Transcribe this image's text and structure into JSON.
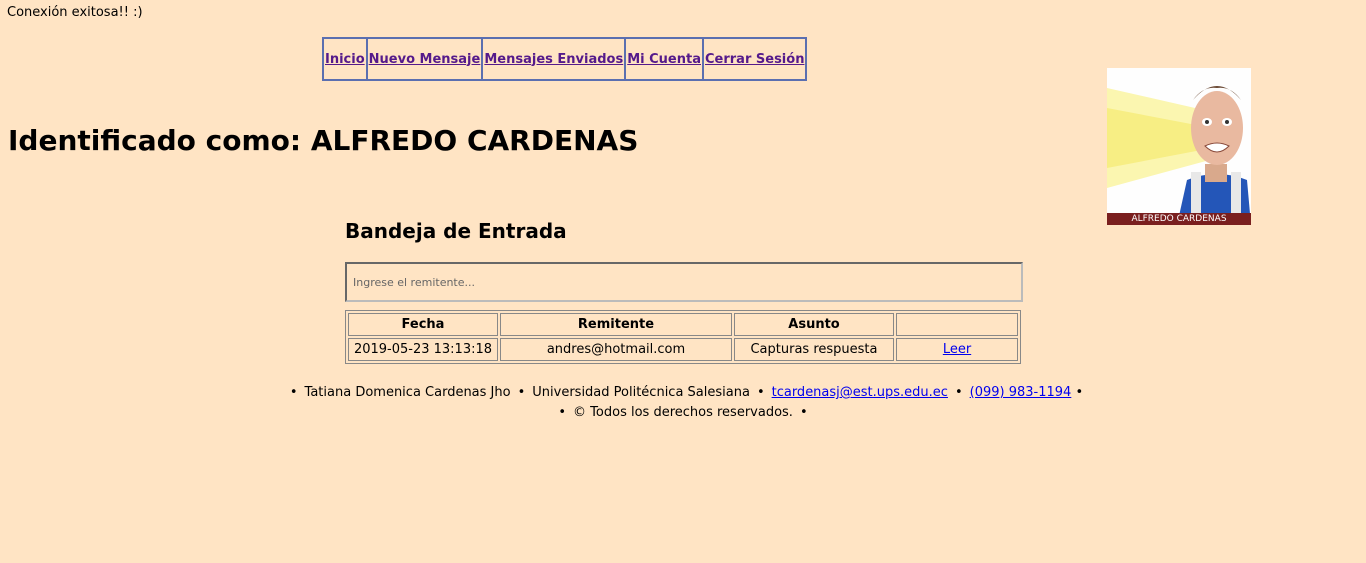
{
  "status": "Conexión exitosa!! :)",
  "nav": {
    "items": [
      "Inicio",
      "Nuevo Mensaje",
      "Mensajes Enviados",
      "Mi Cuenta",
      "Cerrar Sesión"
    ],
    "color": "#551a8b"
  },
  "user": {
    "label": "Identificado como:",
    "name": "ALFREDO CARDENAS",
    "avatar_caption": "ALFREDO CARDENAS"
  },
  "inbox": {
    "title": "Bandeja de Entrada",
    "search_placeholder": "Ingrese el remitente...",
    "columns": [
      "Fecha",
      "Remitente",
      "Asunto",
      ""
    ],
    "rows": [
      {
        "fecha": "2019-05-23 13:13:18",
        "remitente": "andres@hotmail.com",
        "asunto": "Capturas respuesta",
        "accion": "Leer"
      }
    ]
  },
  "footer": {
    "author": "Tatiana Domenica Cardenas Jho",
    "university": "Universidad Politécnica Salesiana",
    "email": "tcardenasj@est.ups.edu.ec",
    "phone": "(099) 983-1194",
    "copyright": "© Todos los derechos reservados."
  },
  "colors": {
    "background": "#ffe4c4",
    "nav_border": "#5b6fb0",
    "caption_bg": "#7a1f1f"
  }
}
